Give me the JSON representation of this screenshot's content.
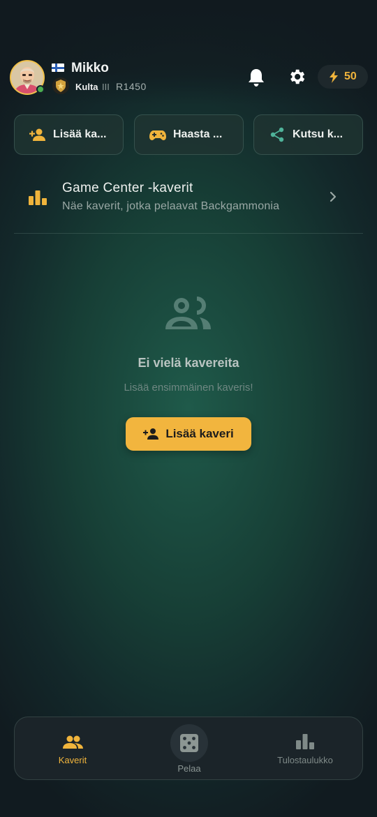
{
  "header": {
    "username": "Mikko",
    "country_flag": "finland-flag",
    "rank_name": "Kulta",
    "rank_tier": "III",
    "rating": "R1450",
    "energy": "50",
    "online": true
  },
  "actions": [
    {
      "label": "Lisää ka...",
      "icon": "add-user-icon"
    },
    {
      "label": "Haasta ...",
      "icon": "gamepad-icon"
    },
    {
      "label": "Kutsu k...",
      "icon": "share-icon"
    }
  ],
  "game_center": {
    "title": "Game Center -kaverit",
    "subtitle": "Näe kaverit, jotka pelaavat Backgammonia",
    "icon": "bar-chart-icon"
  },
  "empty_state": {
    "title": "Ei vielä kavereita",
    "subtitle": "Lisää ensimmäinen kaveris!",
    "button_label": "Lisää kaveri"
  },
  "bottom_nav": {
    "items": [
      {
        "label": "Kaverit",
        "icon": "friends-icon",
        "active": true
      },
      {
        "label": "Pelaa",
        "icon": "dice-icon",
        "active": false
      },
      {
        "label": "Tulostaulukko",
        "icon": "leaderboard-icon",
        "active": false
      }
    ]
  },
  "colors": {
    "accent": "#f2b53e",
    "teal_icon": "#4fb39a",
    "background": "#173f36"
  }
}
